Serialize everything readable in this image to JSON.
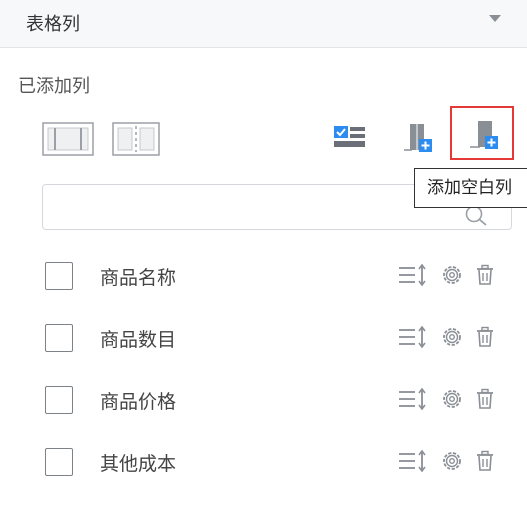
{
  "section": {
    "title": "表格列"
  },
  "added": {
    "label": "已添加列"
  },
  "tooltip": {
    "text": "添加空白列"
  },
  "search": {
    "value": "",
    "placeholder": ""
  },
  "columns": [
    {
      "label": "商品名称",
      "checked": false
    },
    {
      "label": "商品数目",
      "checked": false
    },
    {
      "label": "商品价格",
      "checked": false
    },
    {
      "label": "其他成本",
      "checked": false
    }
  ],
  "colors": {
    "accent": "#2d8cf0",
    "highlight": "#e53935",
    "icon": "#8a8f96"
  }
}
